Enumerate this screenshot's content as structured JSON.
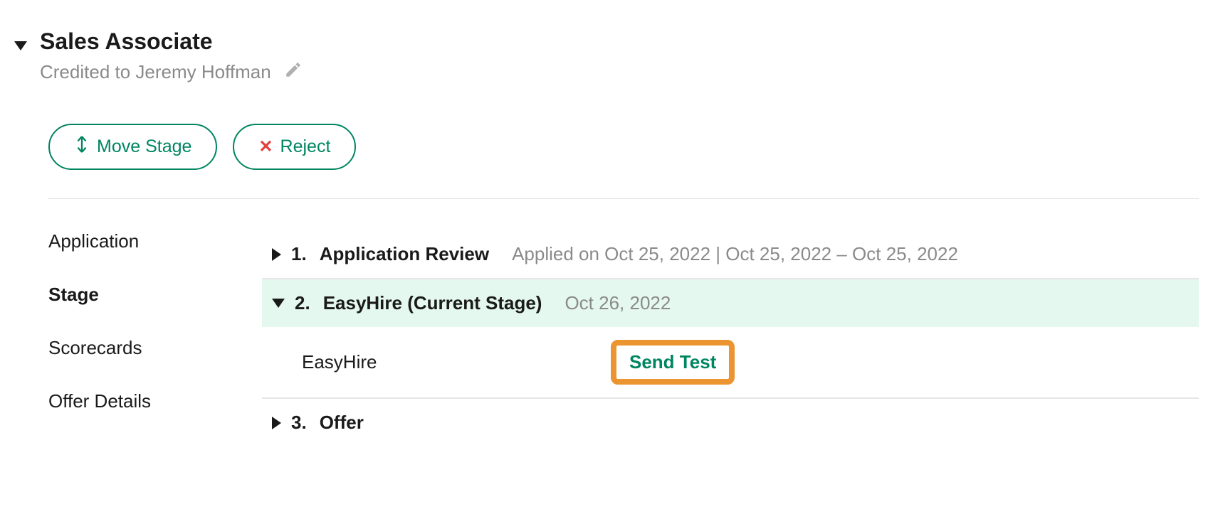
{
  "header": {
    "job_title": "Sales Associate",
    "credited_to": "Credited to Jeremy Hoffman"
  },
  "actions": {
    "move_stage": "Move Stage",
    "reject": "Reject"
  },
  "sidebar": {
    "items": [
      {
        "label": "Application"
      },
      {
        "label": "Stage"
      },
      {
        "label": "Scorecards"
      },
      {
        "label": "Offer Details"
      }
    ]
  },
  "stages": [
    {
      "number": "1.",
      "name": "Application Review",
      "meta": "Applied on Oct 25, 2022 | Oct 25, 2022 – Oct 25, 2022"
    },
    {
      "number": "2.",
      "name": "EasyHire (Current Stage)",
      "meta": "Oct 26, 2022",
      "substage": {
        "label": "EasyHire",
        "action": "Send Test"
      }
    },
    {
      "number": "3.",
      "name": "Offer"
    }
  ]
}
